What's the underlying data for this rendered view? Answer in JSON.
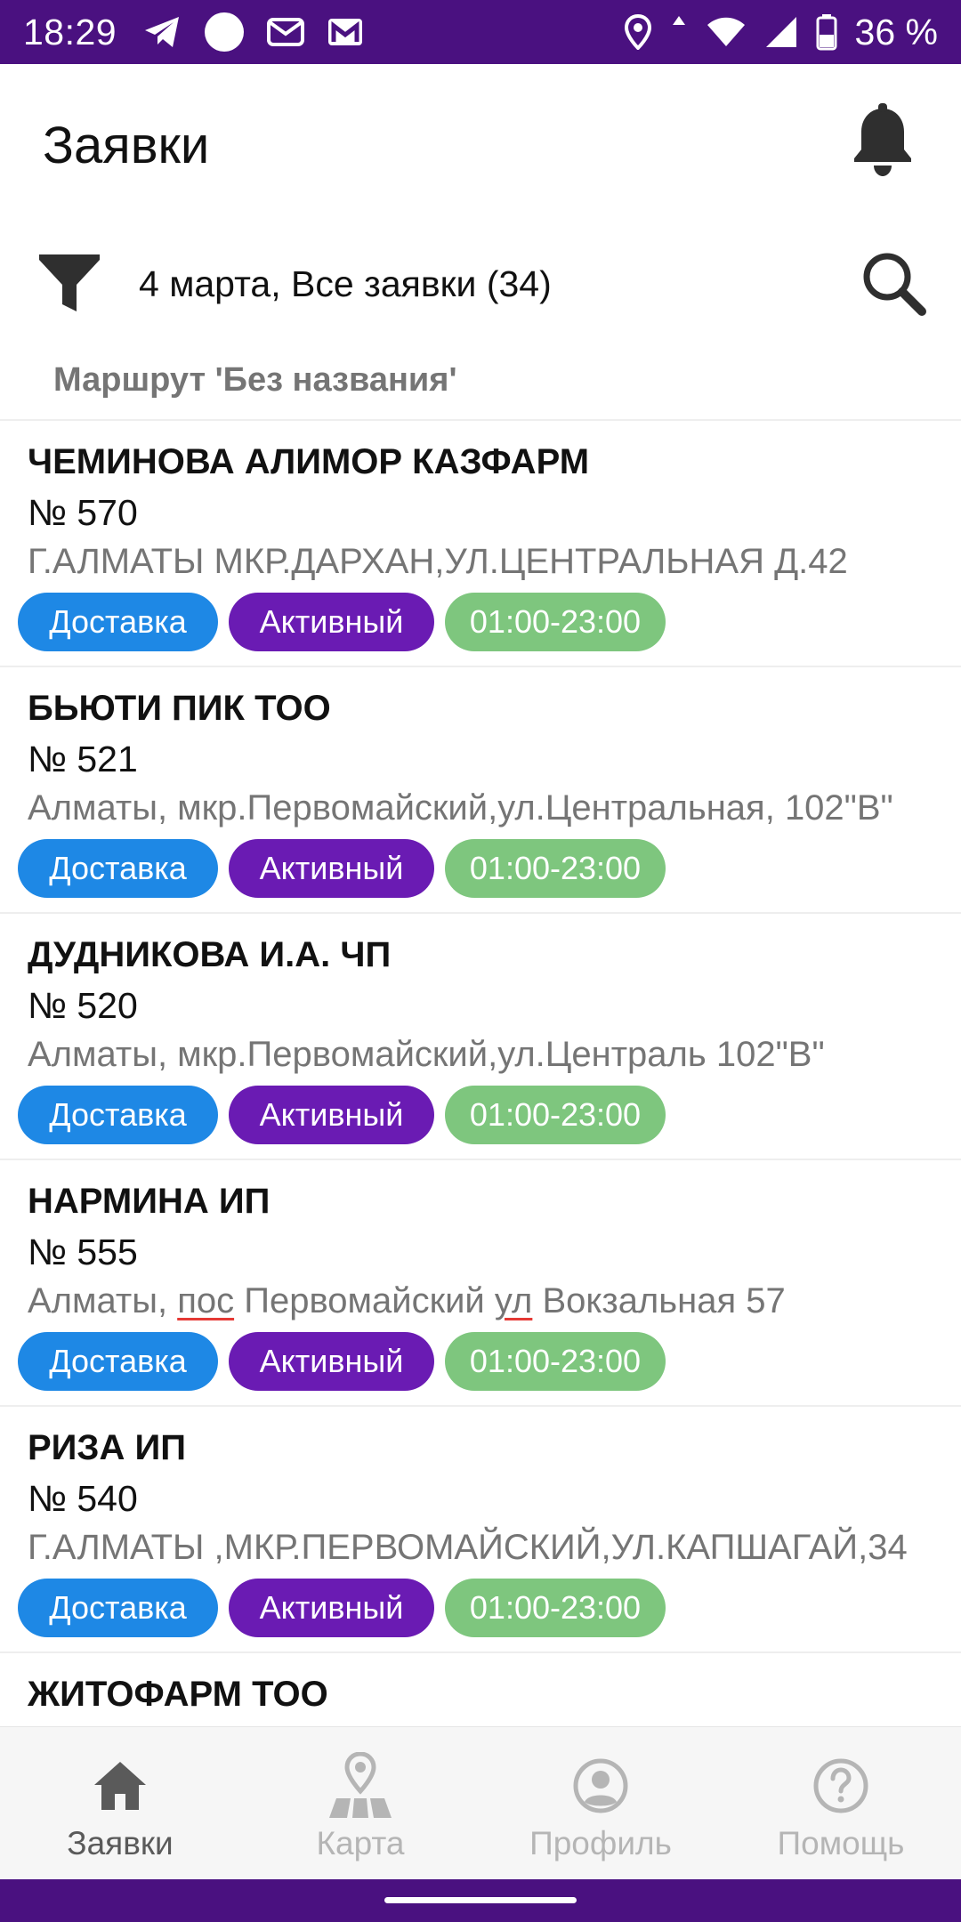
{
  "status_bar": {
    "time": "18:29",
    "battery_text": "36 %",
    "icons_left": [
      "telegram-icon",
      "circle-icon",
      "mail-icon",
      "gmail-icon"
    ],
    "icons_right": [
      "location-icon",
      "data-arrows-icon",
      "wifi-icon",
      "signal-icon",
      "battery-icon"
    ]
  },
  "header": {
    "title": "Заявки",
    "bell_icon": "bell-icon"
  },
  "filter": {
    "text": "4 марта, Все заявки (34)",
    "filter_icon": "filter-icon",
    "search_icon": "search-icon"
  },
  "route": {
    "label": "Маршрут 'Без названия'"
  },
  "orders": [
    {
      "name": "ЧЕМИНОВА АЛИМОР КАЗФАРМ",
      "number": "№ 570",
      "address": "Г.АЛМАТЫ МКР.ДАРХАН,УЛ.ЦЕНТРАЛЬНАЯ Д.42",
      "type": "Доставка",
      "status": "Активный",
      "time": "01:00-23:00"
    },
    {
      "name": "БЬЮТИ ПИК ТОО",
      "number": "№ 521",
      "address": "Алматы, мкр.Первомайский,ул.Центральная, 102\"В\"",
      "type": "Доставка",
      "status": "Активный",
      "time": "01:00-23:00"
    },
    {
      "name": "ДУДНИКОВА И.А. ЧП",
      "number": "№ 520",
      "address": "Алматы, мкр.Первомайский,ул.Централь 102\"В\"",
      "type": "Доставка",
      "status": "Активный",
      "time": "01:00-23:00"
    },
    {
      "name": "НАРМИНА ИП",
      "number": "№ 555",
      "address_parts": [
        "Алматы, ",
        "пос",
        " Первомайский ",
        "ул",
        " Вокзальная 57"
      ],
      "type": "Доставка",
      "status": "Активный",
      "time": "01:00-23:00"
    },
    {
      "name": "РИЗА ИП",
      "number": "№ 540",
      "address": "Г.АЛМАТЫ ,МКР.ПЕРВОМАЙСКИЙ,УЛ.КАПШАГАЙ,34",
      "type": "Доставка",
      "status": "Активный",
      "time": "01:00-23:00"
    },
    {
      "name": "ЖИТОФАРМ ТОО"
    }
  ],
  "bottom_nav": [
    {
      "label": "Заявки",
      "icon": "home-icon",
      "selected": true
    },
    {
      "label": "Карта",
      "icon": "map-icon",
      "selected": false
    },
    {
      "label": "Профиль",
      "icon": "profile-icon",
      "selected": false
    },
    {
      "label": "Помощь",
      "icon": "help-icon",
      "selected": false
    }
  ],
  "colors": {
    "status_bar": "#4a1180",
    "delivery_badge": "#1e88e5",
    "active_badge": "#6a1bb3",
    "time_badge": "#7ec67e",
    "spellcheck_underline": "#e53935"
  }
}
